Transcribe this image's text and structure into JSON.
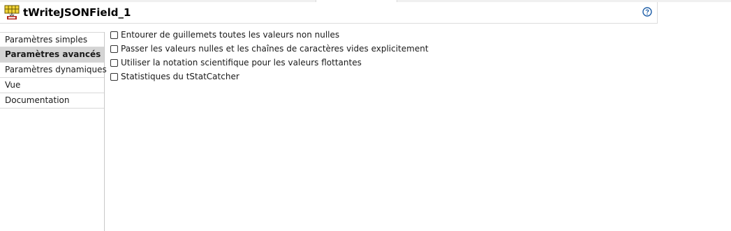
{
  "header": {
    "title": "tWriteJSONField_1",
    "component_icon": "json-component-icon",
    "help_icon": "help-icon"
  },
  "sidebar": {
    "items": [
      {
        "label": "Paramètres simples",
        "selected": false
      },
      {
        "label": "Paramètres avancés",
        "selected": true
      },
      {
        "label": "Paramètres dynamiques",
        "selected": false
      },
      {
        "label": "Vue",
        "selected": false
      },
      {
        "label": "Documentation",
        "selected": false
      }
    ]
  },
  "options": [
    {
      "label": "Entourer de guillemets toutes les valeurs non nulles",
      "checked": false
    },
    {
      "label": "Passer les valeurs nulles et les chaînes de caractères vides explicitement",
      "checked": false
    },
    {
      "label": "Utiliser la notation scientifique pour les valeurs flottantes",
      "checked": false
    },
    {
      "label": "Statistiques du tStatCatcher",
      "checked": false
    }
  ],
  "colors": {
    "selected_bg": "#d4d4d4",
    "help_blue": "#1f5fa8",
    "icon_yellow": "#f2d43a",
    "icon_red": "#b3261e"
  }
}
